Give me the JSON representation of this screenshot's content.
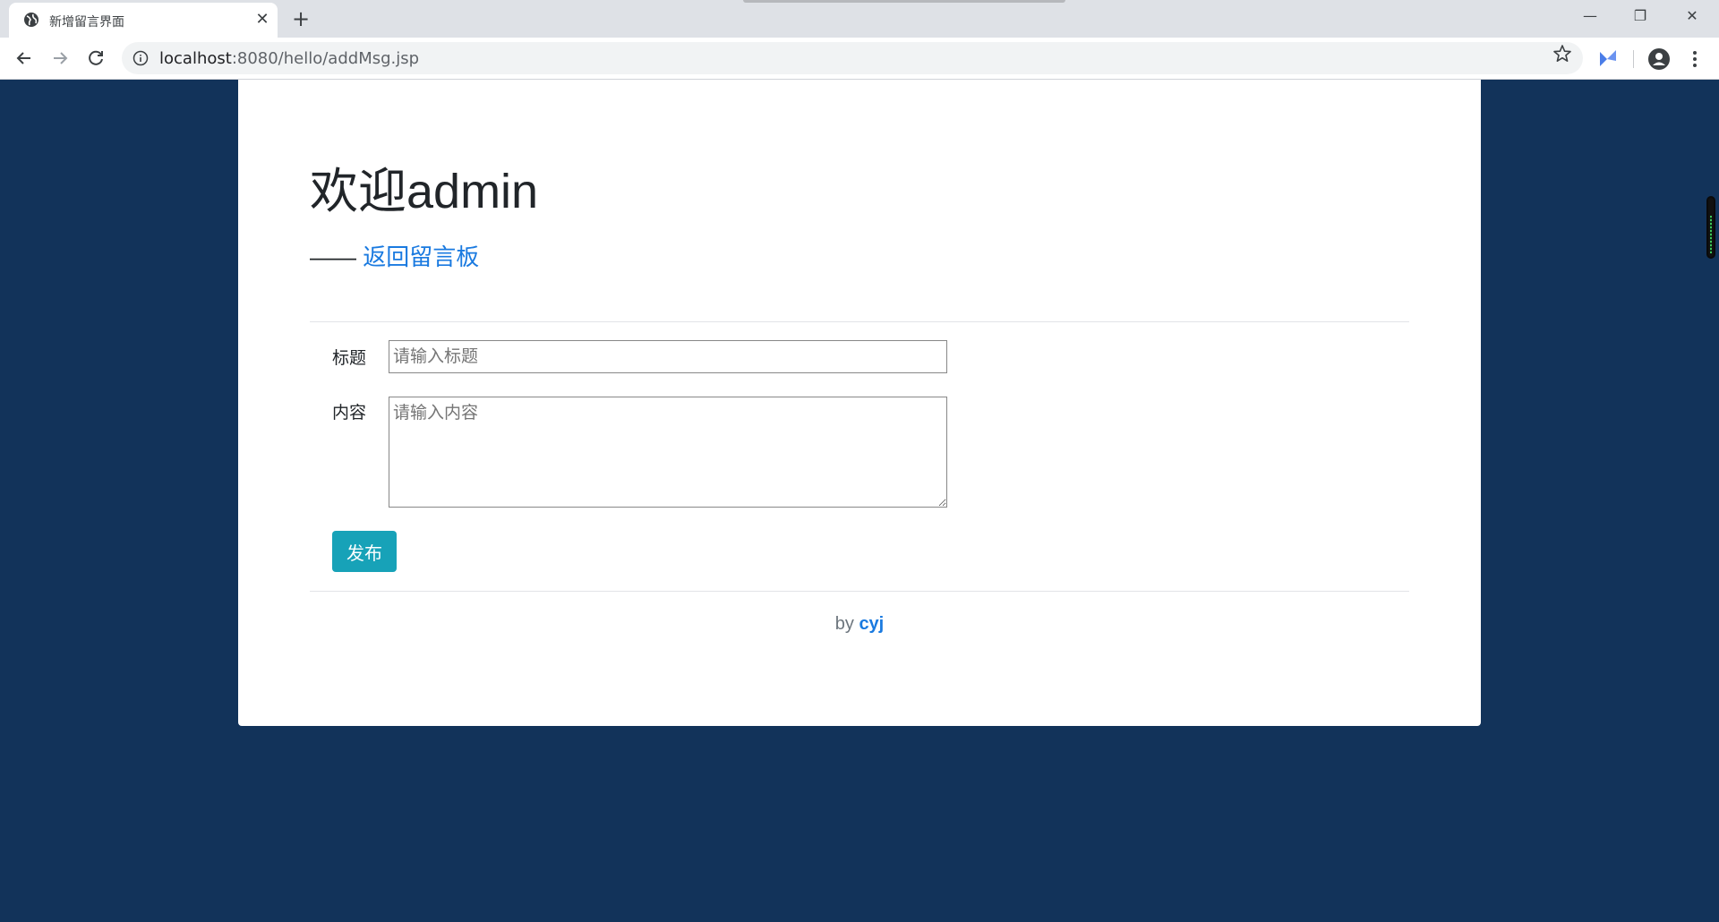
{
  "browser": {
    "tab_title": "新增留言界面",
    "tab_close": "✕",
    "new_tab": "+",
    "url_host": "localhost",
    "url_rest": ":8080/hello/addMsg.jsp",
    "window": {
      "minimize": "—",
      "restore": "❐",
      "close": "✕"
    }
  },
  "page": {
    "heading": "欢迎admin",
    "back_prefix": "—— ",
    "back_link": "返回留言板",
    "form": {
      "title_label": "标题",
      "title_placeholder": "请输入标题",
      "content_label": "内容",
      "content_placeholder": "请输入内容",
      "submit_label": "发布"
    },
    "footer": {
      "by": "by ",
      "author": "cyj"
    }
  },
  "colors": {
    "page_background": "#12335a",
    "link": "#1a7ae0",
    "button": "#17a2b8"
  }
}
